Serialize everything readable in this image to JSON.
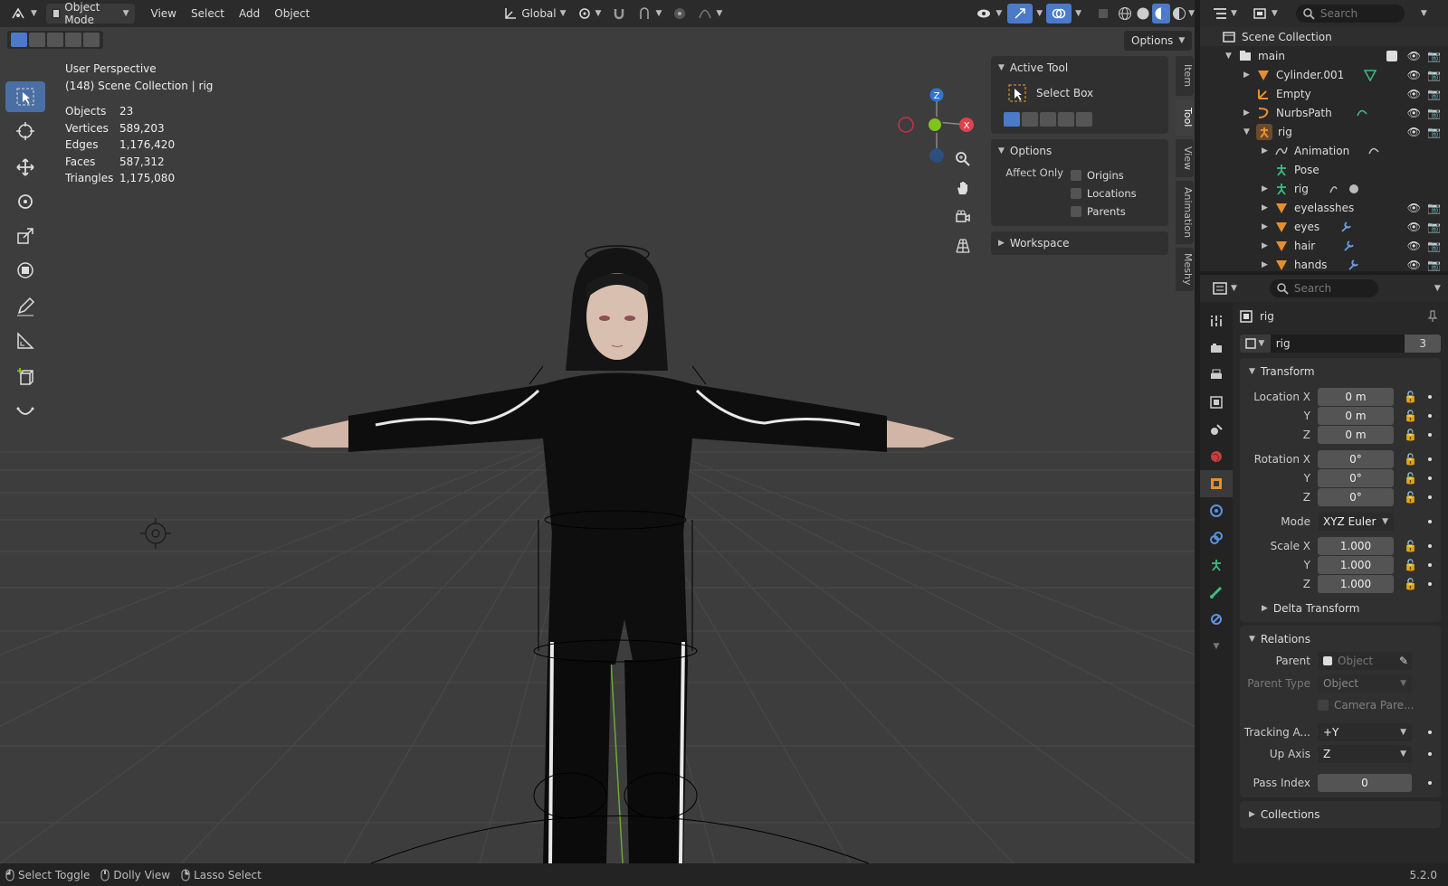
{
  "header": {
    "mode": "Object Mode",
    "menus": [
      "View",
      "Select",
      "Add",
      "Object"
    ],
    "orientation": "Global",
    "options": "Options"
  },
  "viewport": {
    "perspective": "User Perspective",
    "collection": "(148) Scene Collection | rig",
    "stats": [
      {
        "label": "Objects",
        "value": "23"
      },
      {
        "label": "Vertices",
        "value": "589,203"
      },
      {
        "label": "Edges",
        "value": "1,176,420"
      },
      {
        "label": "Faces",
        "value": "587,312"
      },
      {
        "label": "Triangles",
        "value": "1,175,080"
      }
    ],
    "gizmo": {
      "x": "X",
      "y": "Y",
      "z": "Z"
    }
  },
  "npanel": {
    "active_tool_title": "Active Tool",
    "tool_name": "Select Box",
    "options_title": "Options",
    "affect_only": "Affect Only",
    "checks": [
      "Origins",
      "Locations",
      "Parents"
    ],
    "workspace_title": "Workspace",
    "tabs": [
      "Item",
      "Tool",
      "View",
      "Animation",
      "Meshy"
    ]
  },
  "outliner": {
    "search_placeholder": "Search",
    "root": "Scene Collection",
    "items": [
      {
        "name": "main",
        "indent": 1
      },
      {
        "name": "Cylinder.001",
        "indent": 2
      },
      {
        "name": "Empty",
        "indent": 2
      },
      {
        "name": "NurbsPath",
        "indent": 2
      },
      {
        "name": "rig",
        "indent": 2
      },
      {
        "name": "Animation",
        "indent": 3
      },
      {
        "name": "Pose",
        "indent": 3
      },
      {
        "name": "rig",
        "indent": 3
      },
      {
        "name": "eyelasshes",
        "indent": 3
      },
      {
        "name": "eyes",
        "indent": 3
      },
      {
        "name": "hair",
        "indent": 3
      },
      {
        "name": "hands",
        "indent": 3
      }
    ]
  },
  "properties": {
    "search_placeholder": "Search",
    "object_name": "rig",
    "data_name": "rig",
    "users": "3",
    "transform_title": "Transform",
    "location_label": "Location X",
    "rotation_label": "Rotation X",
    "scale_label": "Scale X",
    "axis_y": "Y",
    "axis_z": "Z",
    "location": [
      "0 m",
      "0 m",
      "0 m"
    ],
    "rotation": [
      "0°",
      "0°",
      "0°"
    ],
    "mode_label": "Mode",
    "mode_value": "XYZ Euler",
    "scale": [
      "1.000",
      "1.000",
      "1.000"
    ],
    "delta_title": "Delta Transform",
    "relations_title": "Relations",
    "parent_label": "Parent",
    "parent_placeholder": "Object",
    "parent_type_label": "Parent Type",
    "parent_type_value": "Object",
    "camera_parent": "Camera Pare...",
    "tracking_label": "Tracking A...",
    "tracking_value": "+Y",
    "up_axis_label": "Up Axis",
    "up_axis_value": "Z",
    "pass_index_label": "Pass Index",
    "pass_index_value": "0",
    "collections_title": "Collections"
  },
  "statusbar": {
    "items": [
      "Select Toggle",
      "Dolly View",
      "Lasso Select"
    ],
    "version": "5.2.0"
  },
  "colors": {
    "accent": "#4a7ac9",
    "active_tool": "#4a6fa5",
    "x_axis": "#e0404f",
    "y_axis": "#7fc31c",
    "z_axis": "#3b7ed6"
  }
}
